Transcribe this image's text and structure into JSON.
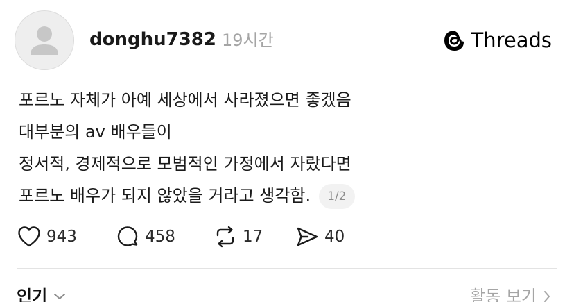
{
  "post": {
    "author": "donghu7382",
    "time_ago": "19시간",
    "brand": "Threads",
    "lines": [
      "포르노 자체가 아예 세상에서 사라졌으면 좋겠음",
      "대부분의 av 배우들이",
      "정서적, 경제적으로 모범적인 가정에서 자랐다면",
      "포르노 배우가 되지 않았을 거라고 생각함."
    ],
    "page_indicator": "1/2"
  },
  "actions": {
    "likes": "943",
    "comments": "458",
    "reposts": "17",
    "shares": "40"
  },
  "footer": {
    "sort_label": "인기",
    "activity_link": "활동 보기"
  },
  "icons": {
    "avatar": "default-avatar-icon",
    "brand": "threads-logo-icon",
    "like": "heart-icon",
    "comment": "comment-bubble-icon",
    "repost": "repost-icon",
    "share": "share-send-icon",
    "sort": "chevron-down-icon",
    "activity": "chevron-right-icon"
  },
  "colors": {
    "text": "#1a1a1a",
    "muted": "#a5a5a5",
    "badge_bg": "#f2f2f2",
    "avatar_bg": "#eeeeee",
    "avatar_fg": "#c7c7c7"
  }
}
